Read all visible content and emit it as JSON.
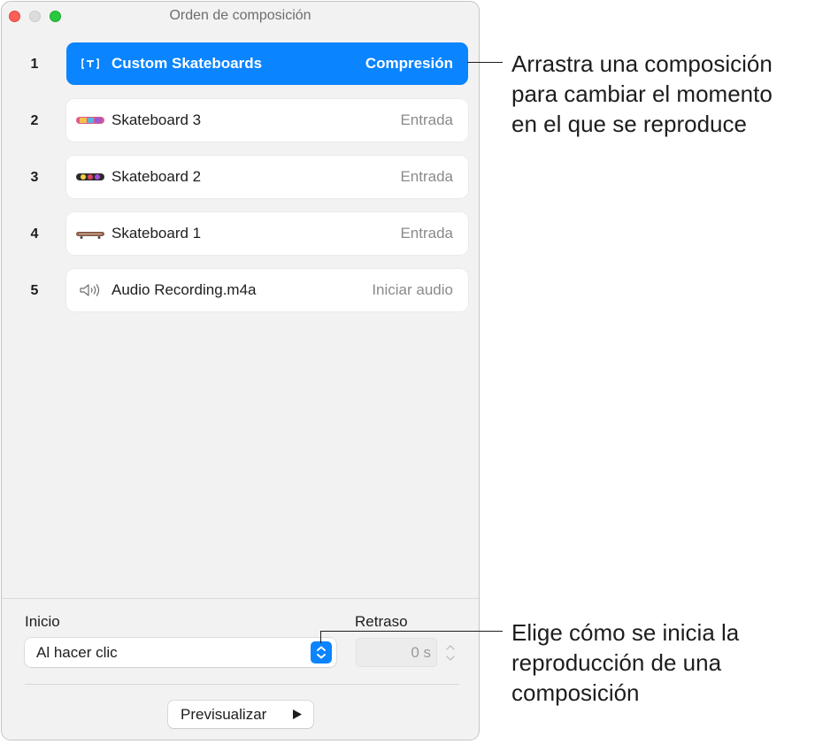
{
  "window": {
    "title": "Orden de composición"
  },
  "builds": [
    {
      "number": "1",
      "name": "Custom Skateboards",
      "effect": "Compresión",
      "selected": true,
      "icon": "text-box-icon"
    },
    {
      "number": "2",
      "name": "Skateboard 3",
      "effect": "Entrada",
      "selected": false,
      "icon": "skateboard-3-thumbnail"
    },
    {
      "number": "3",
      "name": "Skateboard 2",
      "effect": "Entrada",
      "selected": false,
      "icon": "skateboard-2-thumbnail"
    },
    {
      "number": "4",
      "name": "Skateboard 1",
      "effect": "Entrada",
      "selected": false,
      "icon": "skateboard-1-thumbnail"
    },
    {
      "number": "5",
      "name": "Audio Recording.m4a",
      "effect": "Iniciar audio",
      "selected": false,
      "icon": "speaker-icon"
    }
  ],
  "controls": {
    "start_label": "Inicio",
    "start_value": "Al hacer clic",
    "delay_label": "Retraso",
    "delay_value": "0 s",
    "preview_label": "Previsualizar"
  },
  "callouts": {
    "top": "Arrastra una composición\npara cambiar el momento\nen el que se reproduce",
    "bottom": "Elige cómo se inicia la\nreproducción de una\ncomposición"
  },
  "colors": {
    "accent": "#0a84ff",
    "close": "#fe5f57",
    "zoom": "#28c840"
  }
}
